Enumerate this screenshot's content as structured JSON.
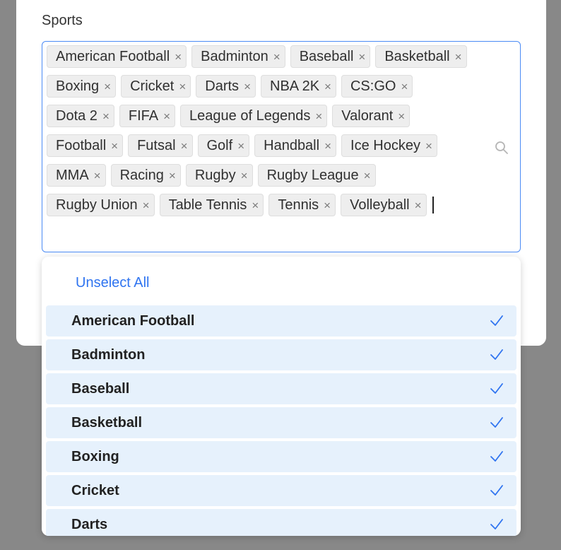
{
  "field": {
    "label": "Sports"
  },
  "selected_chips": [
    "American Football",
    "Badminton",
    "Baseball",
    "Basketball",
    "Boxing",
    "Cricket",
    "Darts",
    "NBA 2K",
    "CS:GO",
    "Dota 2",
    "FIFA",
    "League of Legends",
    "Valorant",
    "Football",
    "Futsal",
    "Golf",
    "Handball",
    "Ice Hockey",
    "MMA",
    "Racing",
    "Rugby",
    "Rugby League",
    "Rugby Union",
    "Table Tennis",
    "Tennis",
    "Volleyball"
  ],
  "chip_remove_glyph": "×",
  "icons": {
    "search": "search-icon",
    "check": "check-icon",
    "remove": "close-icon"
  },
  "colors": {
    "accent": "#2f74f0",
    "selected_bg": "#e6f1fc",
    "overlay": "#888888"
  },
  "dropdown": {
    "unselect_all_label": "Unselect All",
    "options": [
      {
        "label": "American Football",
        "selected": true
      },
      {
        "label": "Badminton",
        "selected": true
      },
      {
        "label": "Baseball",
        "selected": true
      },
      {
        "label": "Basketball",
        "selected": true
      },
      {
        "label": "Boxing",
        "selected": true
      },
      {
        "label": "Cricket",
        "selected": true
      },
      {
        "label": "Darts",
        "selected": true
      }
    ]
  }
}
